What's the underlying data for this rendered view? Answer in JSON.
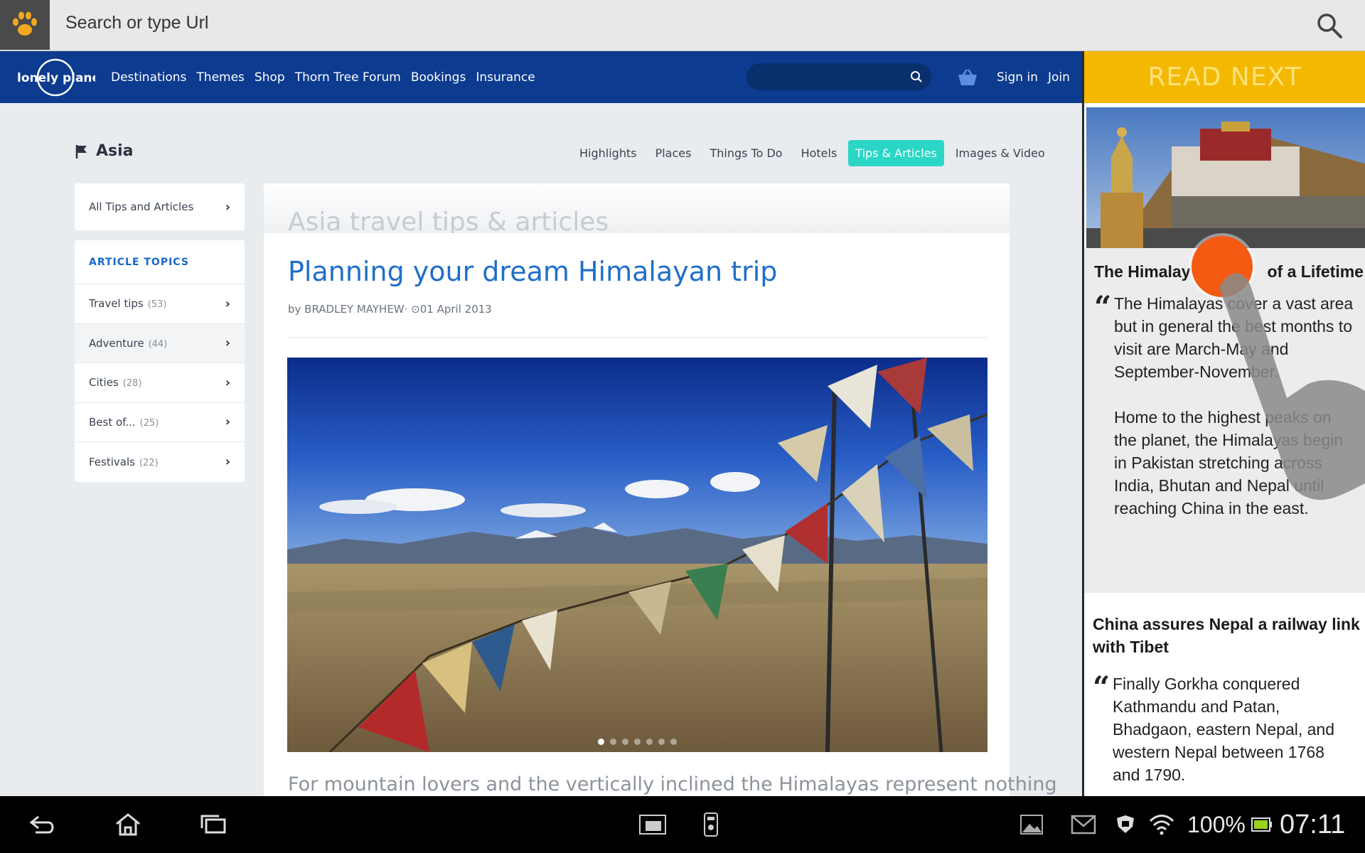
{
  "browser": {
    "url_placeholder": "Search or type Url",
    "logo_icon": "paw-icon",
    "search_icon": "search-icon"
  },
  "site": {
    "logo_text": "lonely planet",
    "nav": [
      "Destinations",
      "Themes",
      "Shop",
      "Thorn Tree Forum",
      "Bookings",
      "Insurance"
    ],
    "basket_icon": "basket-icon",
    "sign_in": "Sign in",
    "join": "Join"
  },
  "page": {
    "region": "Asia",
    "tabs": [
      {
        "label": "Highlights",
        "active": false
      },
      {
        "label": "Places",
        "active": false
      },
      {
        "label": "Things To Do",
        "active": false
      },
      {
        "label": "Hotels",
        "active": false
      },
      {
        "label": "Tips & Articles",
        "active": true
      },
      {
        "label": "Images & Video",
        "active": false
      }
    ]
  },
  "sidebar": {
    "all_link": "All Tips and Articles",
    "topics_heading": "ARTICLE TOPICS",
    "topics": [
      {
        "label": "Travel tips",
        "count": "(53)"
      },
      {
        "label": "Adventure",
        "count": "(44)"
      },
      {
        "label": "Cities",
        "count": "(28)"
      },
      {
        "label": "Best of...",
        "count": "(25)"
      },
      {
        "label": "Festivals",
        "count": "(22)"
      }
    ]
  },
  "article": {
    "section_heading": "Asia travel tips & articles",
    "title": "Planning your dream Himalayan trip",
    "byline": "by BRADLEY MAYHEW· ⊙01 April 2013",
    "lead": "For mountain lovers and the vertically inclined the Himalayas represent nothing",
    "slide_count": 7,
    "active_slide": 1
  },
  "read_next": {
    "heading": "READ NEXT",
    "items": [
      {
        "title": "The Himalayas: Trip of a Lifetime",
        "title_visible_start": "The Himalay",
        "title_visible_end": "of a Lifetime",
        "paragraphs": [
          "The Himalayas cover a vast area but in general the best months to visit are March-May and September-November.",
          "Home to the highest peaks on the planet, the Himalayas begin in Pakistan stretching across India, Bhutan and Nepal until reaching China in the east."
        ]
      },
      {
        "title": "China assures Nepal a railway link with Tibet",
        "paragraphs": [
          "Finally Gorkha conquered Kathmandu and Patan, Bhadgaon, eastern Nepal, and western Nepal between 1768 and 1790."
        ]
      }
    ]
  },
  "system_bar": {
    "battery": "100%",
    "time": "07:11",
    "icons": [
      "back-icon",
      "home-icon",
      "recents-icon",
      "screenshot-icon",
      "remote-icon",
      "gallery-icon",
      "gmail-icon",
      "shield-icon",
      "wifi-icon",
      "battery-icon"
    ]
  },
  "colors": {
    "nav_blue": "#0c3b8f",
    "accent_teal": "#2bd6c6",
    "read_next_yellow": "#f5b800",
    "title_blue": "#1f6fc9",
    "touch_orange": "#f55a12"
  }
}
